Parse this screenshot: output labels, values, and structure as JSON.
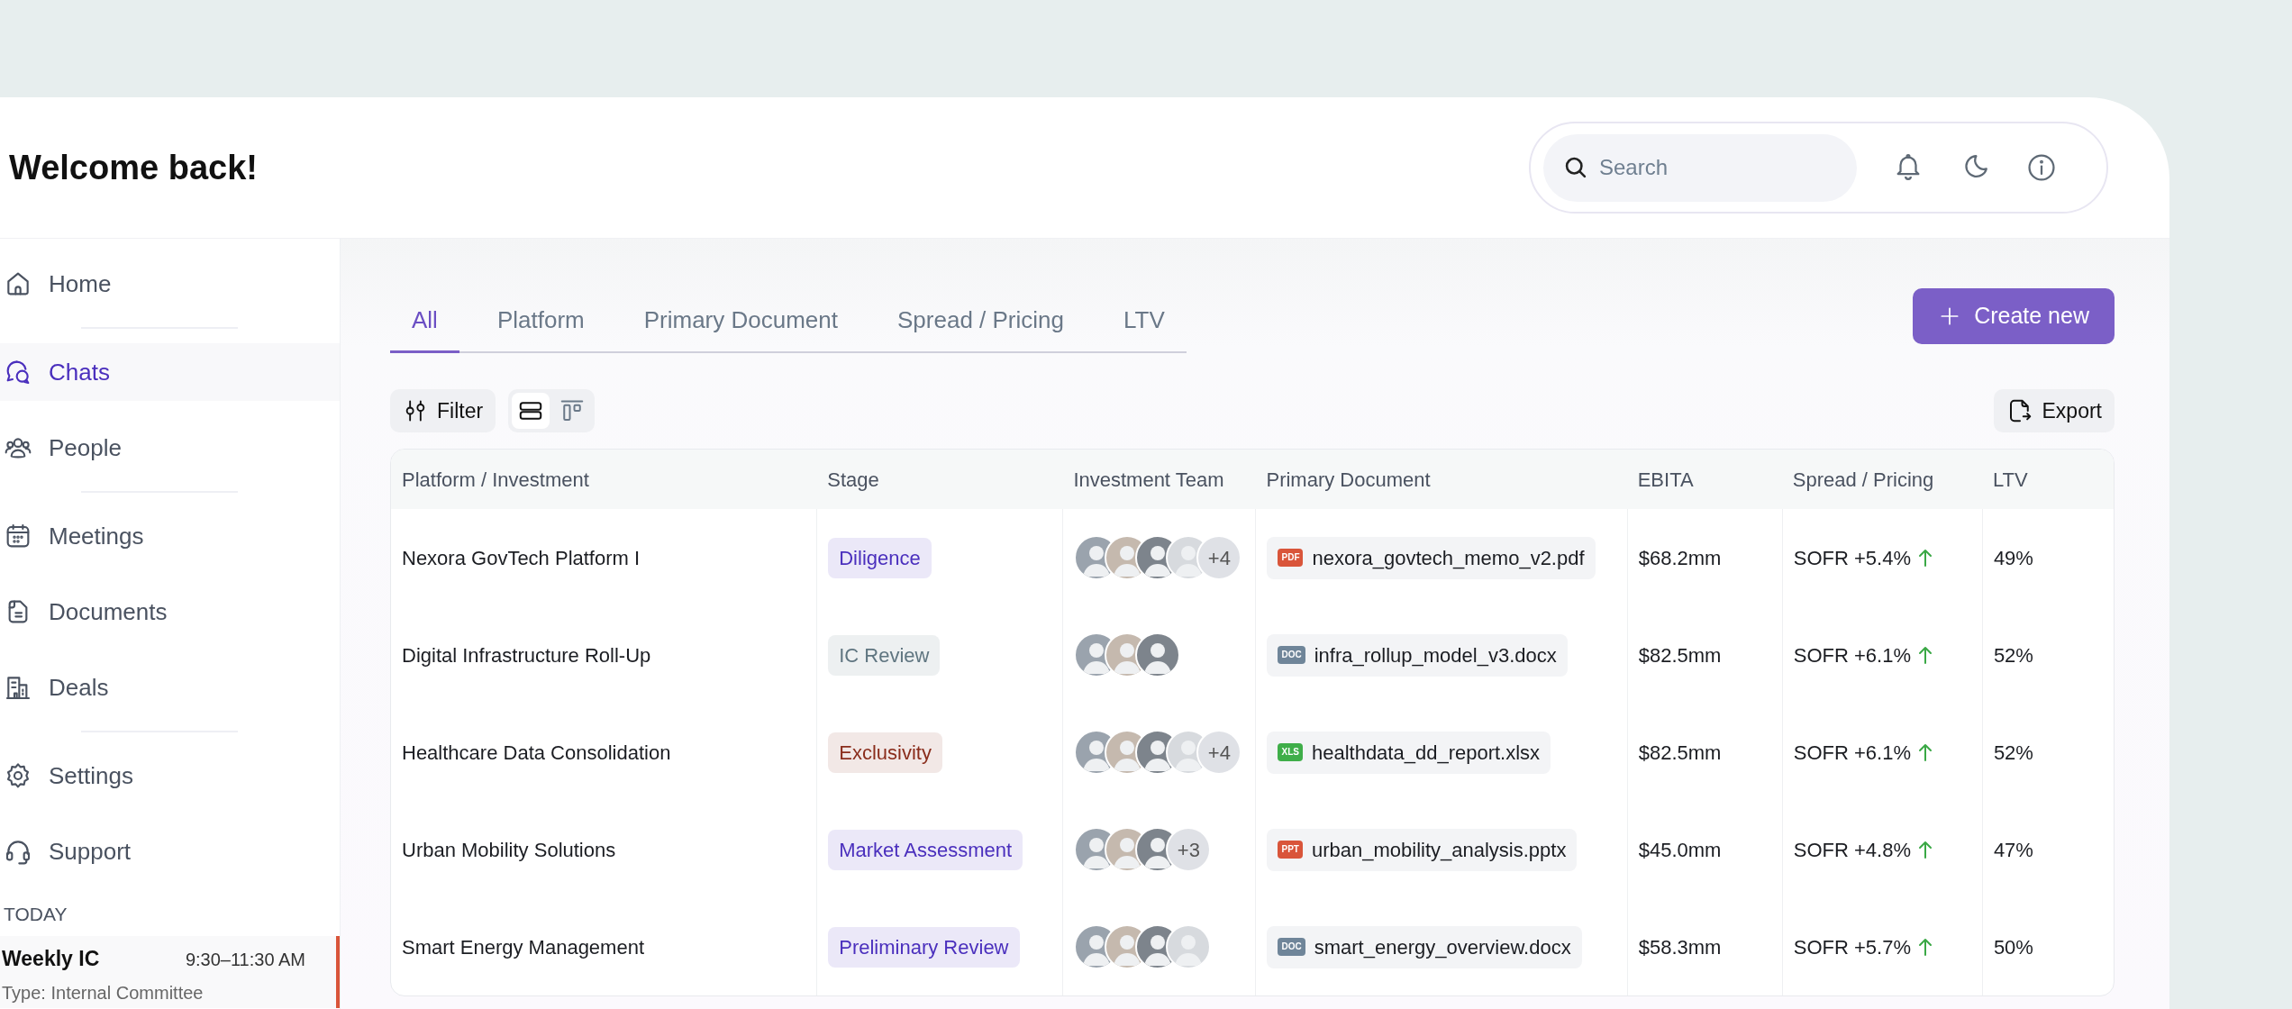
{
  "header": {
    "title": "Welcome back!",
    "search": {
      "placeholder": "Search"
    }
  },
  "sidebar": {
    "items": [
      {
        "label": "Home",
        "kind": "home",
        "selected": false,
        "divider_after": true
      },
      {
        "label": "Chats",
        "kind": "chats",
        "selected": true,
        "divider_after": false
      },
      {
        "label": "People",
        "kind": "people",
        "selected": false,
        "divider_after": true
      },
      {
        "label": "Meetings",
        "kind": "calendar",
        "selected": false,
        "divider_after": false
      },
      {
        "label": "Documents",
        "kind": "document",
        "selected": false,
        "divider_after": false
      },
      {
        "label": "Deals",
        "kind": "building",
        "selected": false,
        "divider_after": true
      },
      {
        "label": "Settings",
        "kind": "gear",
        "selected": false,
        "divider_after": false
      },
      {
        "label": "Support",
        "kind": "headset",
        "selected": false,
        "divider_after": false
      }
    ],
    "today": {
      "heading": "TODAY",
      "meetings": [
        {
          "title": "Weekly IC",
          "time": "9:30–11:30 AM",
          "type": "Type: Internal Committee",
          "color": "#d9553a"
        }
      ]
    }
  },
  "tabs": [
    {
      "label": "All",
      "selected": true
    },
    {
      "label": "Platform",
      "selected": false
    },
    {
      "label": "Primary Document",
      "selected": false
    },
    {
      "label": "Spread / Pricing",
      "selected": false
    },
    {
      "label": "LTV",
      "selected": false
    }
  ],
  "create_button": "Create new",
  "toolbar": {
    "filter": "Filter",
    "views": [
      {
        "kind": "rows",
        "selected": true
      },
      {
        "kind": "board",
        "selected": false
      }
    ],
    "export": "Export"
  },
  "table": {
    "columns": [
      "Platform / Investment",
      "Stage",
      "Investment Team",
      "Primary Document",
      "EBITA",
      "Spread / Pricing",
      "LTV"
    ],
    "rows": [
      {
        "name": "Nexora GovTech Platform I",
        "stage": {
          "label": "Diligence",
          "color": "#4a2fbd"
        },
        "team": {
          "members": [
            {
              "kind": "photo"
            },
            {
              "kind": "photo"
            },
            {
              "kind": "photo"
            },
            {
              "kind": "photo"
            }
          ],
          "more": "+4"
        },
        "doc": {
          "type_label": "PDF",
          "color": "#d9553a",
          "name": "nexora_govtech_memo_v2.pdf"
        },
        "ebita": "$68.2mm",
        "spread": "SOFR +5.4%",
        "rising": true,
        "ltv": "49%"
      },
      {
        "name": "Digital Infrastructure Roll-Up",
        "stage": {
          "label": "IC Review",
          "color": "#5f7580"
        },
        "team": {
          "members": [
            {
              "kind": "photo"
            },
            {
              "kind": "photo"
            },
            {
              "kind": "photo"
            }
          ]
        },
        "doc": {
          "type_label": "DOC",
          "color": "#6f8599",
          "name": "infra_rollup_model_v3.docx"
        },
        "ebita": "$82.5mm",
        "spread": "SOFR +6.1%",
        "rising": true,
        "ltv": "52%"
      },
      {
        "name": "Healthcare Data Consolidation",
        "stage": {
          "label": "Exclusivity",
          "color": "#8a2d1c"
        },
        "team": {
          "members": [
            {
              "kind": "photo"
            },
            {
              "kind": "photo"
            },
            {
              "kind": "photo"
            },
            {
              "kind": "photo"
            }
          ],
          "more": "+4"
        },
        "doc": {
          "type_label": "XLS",
          "color": "#3fae49",
          "name": "healthdata_dd_report.xlsx"
        },
        "ebita": "$82.5mm",
        "spread": "SOFR +6.1%",
        "rising": true,
        "ltv": "52%"
      },
      {
        "name": "Urban Mobility Solutions",
        "stage": {
          "label": "Market Assessment",
          "color": "#4a2fbd"
        },
        "team": {
          "members": [
            {
              "kind": "photo"
            },
            {
              "kind": "photo"
            },
            {
              "kind": "photo"
            }
          ],
          "more": "+3"
        },
        "doc": {
          "type_label": "PPT",
          "color": "#d9553a",
          "name": "urban_mobility_analysis.pptx"
        },
        "ebita": "$45.0mm",
        "spread": "SOFR +4.8%",
        "rising": true,
        "ltv": "47%"
      },
      {
        "name": "Smart Energy Management",
        "stage": {
          "label": "Preliminary Review",
          "color": "#4a2fbd"
        },
        "team": {
          "members": [
            {
              "kind": "photo"
            },
            {
              "kind": "photo"
            },
            {
              "kind": "photo"
            },
            {
              "kind": "photo"
            }
          ]
        },
        "doc": {
          "type_label": "DOC",
          "color": "#6f8599",
          "name": "smart_energy_overview.docx"
        },
        "ebita": "$58.3mm",
        "spread": "SOFR +5.7%",
        "rising": true,
        "ltv": "50%"
      }
    ]
  }
}
